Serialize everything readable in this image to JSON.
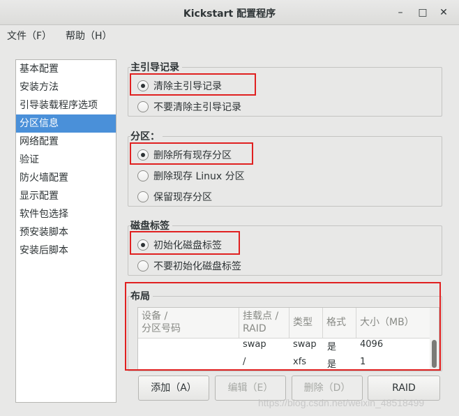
{
  "window": {
    "title": "Kickstart 配置程序",
    "controls": {
      "minimize": "–",
      "maximize": "□",
      "close": "✕"
    }
  },
  "menubar": {
    "file": "文件（F）",
    "help": "帮助（H）"
  },
  "sidebar": {
    "selected_index": 3,
    "items": [
      "基本配置",
      "安装方法",
      "引导装载程序选项",
      "分区信息",
      "网络配置",
      "验证",
      "防火墙配置",
      "显示配置",
      "软件包选择",
      "预安装脚本",
      "安装后脚本"
    ]
  },
  "mbr": {
    "label": "主引导记录",
    "options": [
      {
        "label": "清除主引导记录",
        "selected": true
      },
      {
        "label": "不要清除主引导记录",
        "selected": false
      }
    ]
  },
  "partitions": {
    "label": "分区：",
    "options": [
      {
        "label": "删除所有现存分区",
        "selected": true
      },
      {
        "label": "删除现存  Linux 分区",
        "selected": false
      },
      {
        "label": "保留现存分区",
        "selected": false
      }
    ]
  },
  "disklabel": {
    "label": "磁盘标签",
    "options": [
      {
        "label": "初始化磁盘标签",
        "selected": true
      },
      {
        "label": "不要初始化磁盘标签",
        "selected": false
      }
    ]
  },
  "layout": {
    "label": "布局",
    "columns": [
      {
        "line1": "设备 /",
        "line2": "分区号码"
      },
      {
        "line1": "挂载点 /",
        "line2": "RAID"
      },
      {
        "line1": "类型",
        "line2": ""
      },
      {
        "line1": "格式",
        "line2": ""
      },
      {
        "line1": "大小（MB）",
        "line2": ""
      }
    ],
    "rows": [
      {
        "device": "",
        "mount": "swap",
        "type": "swap",
        "format": "是",
        "size": "4096"
      },
      {
        "device": "",
        "mount": "/",
        "type": "xfs",
        "format": "是",
        "size": "1"
      }
    ]
  },
  "buttons": {
    "add": "添加（A）",
    "edit": "编辑（E）",
    "delete": "删除（D）",
    "raid": "RAID"
  },
  "watermark": "https://blog.csdn.net/weixin_48518499"
}
